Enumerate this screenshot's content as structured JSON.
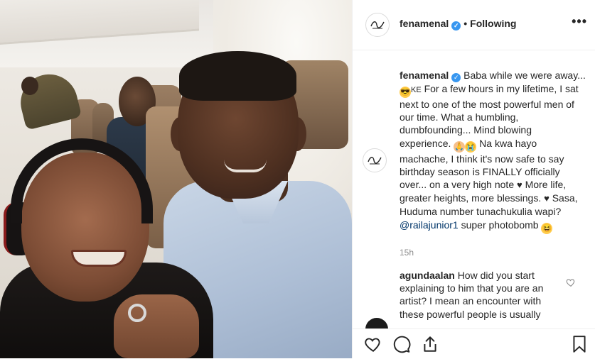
{
  "post": {
    "username": "fenamenal",
    "separator": "•",
    "follow_status": "Following",
    "more_label": "•••"
  },
  "caption": {
    "username": "fenamenal",
    "text_1": "Baba while we were away...",
    "emoji_1": "sunglasses-emoji",
    "flag_label": "KE",
    "text_2": "For a few hours in my lifetime, I sat next to one of the most powerful men of our time. What a humbling, dumbfounding... Mind blowing experience.",
    "emoji_2": "pray-emoji",
    "emoji_3": "crying-emoji",
    "text_3": "Na kwa hayo machache, I think it's now safe to say birthday season is FINALLY officially over... on a very high note",
    "heart_1": "♥",
    "text_4": "More life, greater heights, more blessings.",
    "heart_2": "♥",
    "text_5": "Sasa, Huduma number tunachukulia wapi?",
    "mention": "@railajunior1",
    "text_6": "super photobomb",
    "emoji_4": "grinning-emoji",
    "time": "15h"
  },
  "comment": {
    "username": "agundaalan",
    "text": "How did you start explaining to him that you are an artist? I mean an encounter with these powerful people is usually"
  },
  "icons": {
    "verified": "verified-badge-icon",
    "like": "heart-icon",
    "comment": "comment-bubble-icon",
    "share": "share-upload-icon",
    "save": "bookmark-icon"
  },
  "colors": {
    "verified_blue": "#3897f0",
    "mention_blue": "#003569",
    "text": "#262626",
    "muted": "#8e8e8e",
    "border": "#efefef"
  }
}
